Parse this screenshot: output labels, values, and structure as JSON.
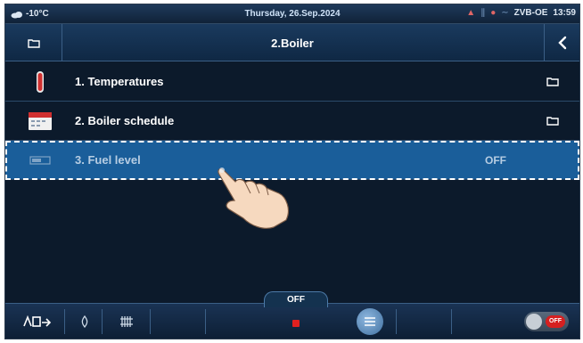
{
  "status_bar": {
    "temperature": "-10°C",
    "date": "Thursday, 26.Sep.2024",
    "device": "ZVB-OE",
    "time": "13:59"
  },
  "title_bar": {
    "title": "2.Boiler"
  },
  "menu": {
    "items": [
      {
        "label": "1.  Temperatures",
        "icon": "thermometer-icon",
        "right": "folder-icon"
      },
      {
        "label": "2.  Boiler schedule",
        "icon": "calendar-icon",
        "right": "folder-icon"
      },
      {
        "label": "3.  Fuel level",
        "icon": "fuel-level-icon",
        "value": "OFF",
        "selected": true
      }
    ]
  },
  "bottom_bar": {
    "off_tab": "OFF",
    "toggle_state": "OFF"
  },
  "colors": {
    "background": "#0c1a2b",
    "selected_row": "#1a5e9a",
    "stop_indicator": "#e02020"
  }
}
